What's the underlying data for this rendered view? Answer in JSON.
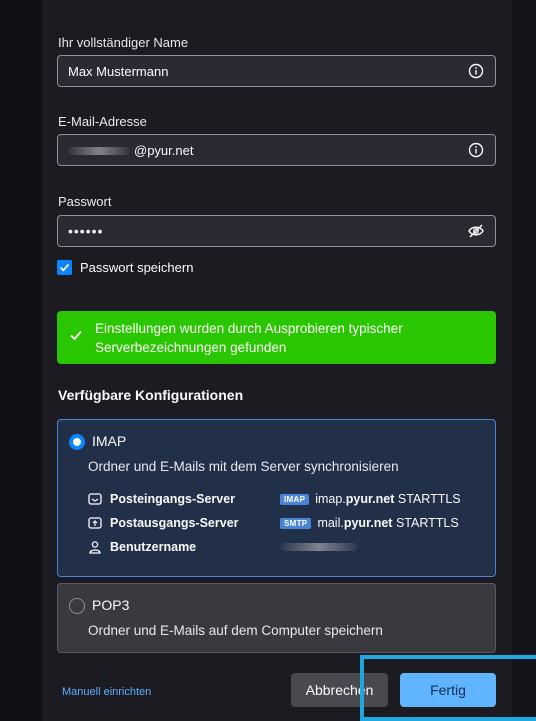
{
  "form": {
    "name_label": "Ihr vollständiger Name",
    "name_value": "Max Mustermann",
    "email_label": "E-Mail-Adresse",
    "email_domain": "@pyur.net",
    "password_label": "Passwort",
    "password_value": "••••••",
    "remember_label": "Passwort speichern"
  },
  "success_message": "Einstellungen wurden durch Ausprobieren typischer Serverbezeichnungen gefunden",
  "configs_heading": "Verfügbare Konfigurationen",
  "imap": {
    "title": "IMAP",
    "description": "Ordner und E-Mails mit dem Server synchronisieren",
    "incoming_label": "Posteingangs-Server",
    "incoming_badge": "IMAP",
    "incoming_host_prefix": "imap.",
    "incoming_host_bold": "pyur.net",
    "incoming_security": "STARTTLS",
    "outgoing_label": "Postausgangs-Server",
    "outgoing_badge": "SMTP",
    "outgoing_host_prefix": "mail.",
    "outgoing_host_bold": "pyur.net",
    "outgoing_security": "STARTTLS",
    "username_label": "Benutzername"
  },
  "pop3": {
    "title": "POP3",
    "description": "Ordner und E-Mails auf dem Computer speichern"
  },
  "footer": {
    "manual_link": "Manuell einrichten",
    "cancel": "Abbrechen",
    "done": "Fertig"
  },
  "colors": {
    "success": "#2ac700",
    "accent": "#0a84ff",
    "primary_button": "#61b4ff",
    "highlight_frame": "#1fa8e0"
  }
}
